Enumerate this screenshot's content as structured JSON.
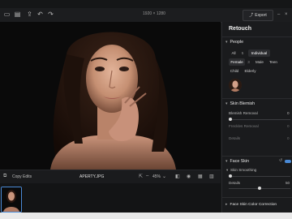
{
  "topbar": {
    "dimensions": "1920 × 1280",
    "export_label": "Export",
    "icons": [
      "folder-icon",
      "save-icon",
      "share-icon",
      "undo-icon",
      "redo-icon"
    ]
  },
  "canvas_footer": {
    "copy_edits": "Copy Edits",
    "filename": "APERTY.JPG",
    "zoom": "45%"
  },
  "panel": {
    "title": "Retouch",
    "people": {
      "header": "People",
      "scope_tabs": [
        "All",
        "5",
        "Individual"
      ],
      "filters_row1": [
        "Female",
        "3",
        "Male",
        "Teen"
      ],
      "filters_row2": [
        "Child",
        "Elderly"
      ]
    },
    "skin_blemish": {
      "header": "Skin Blemish",
      "blemish_removal": "Blemish Removal",
      "freckles_removal": "Freckles Removal",
      "details": "Details",
      "blemish_value": "0",
      "freckles_value": "0",
      "details_value": "0"
    },
    "face_skin": {
      "header": "Face Skin",
      "skin_smoothing": "Skin Smoothing",
      "details": "Details",
      "details_value": "50"
    },
    "face_skin_color": {
      "header": "Face Skin Color Correction"
    }
  },
  "colors": {
    "accent": "#4a8ad6",
    "panel_bg": "#1a1b1d",
    "canvas_bg": "#0a0a0a"
  }
}
